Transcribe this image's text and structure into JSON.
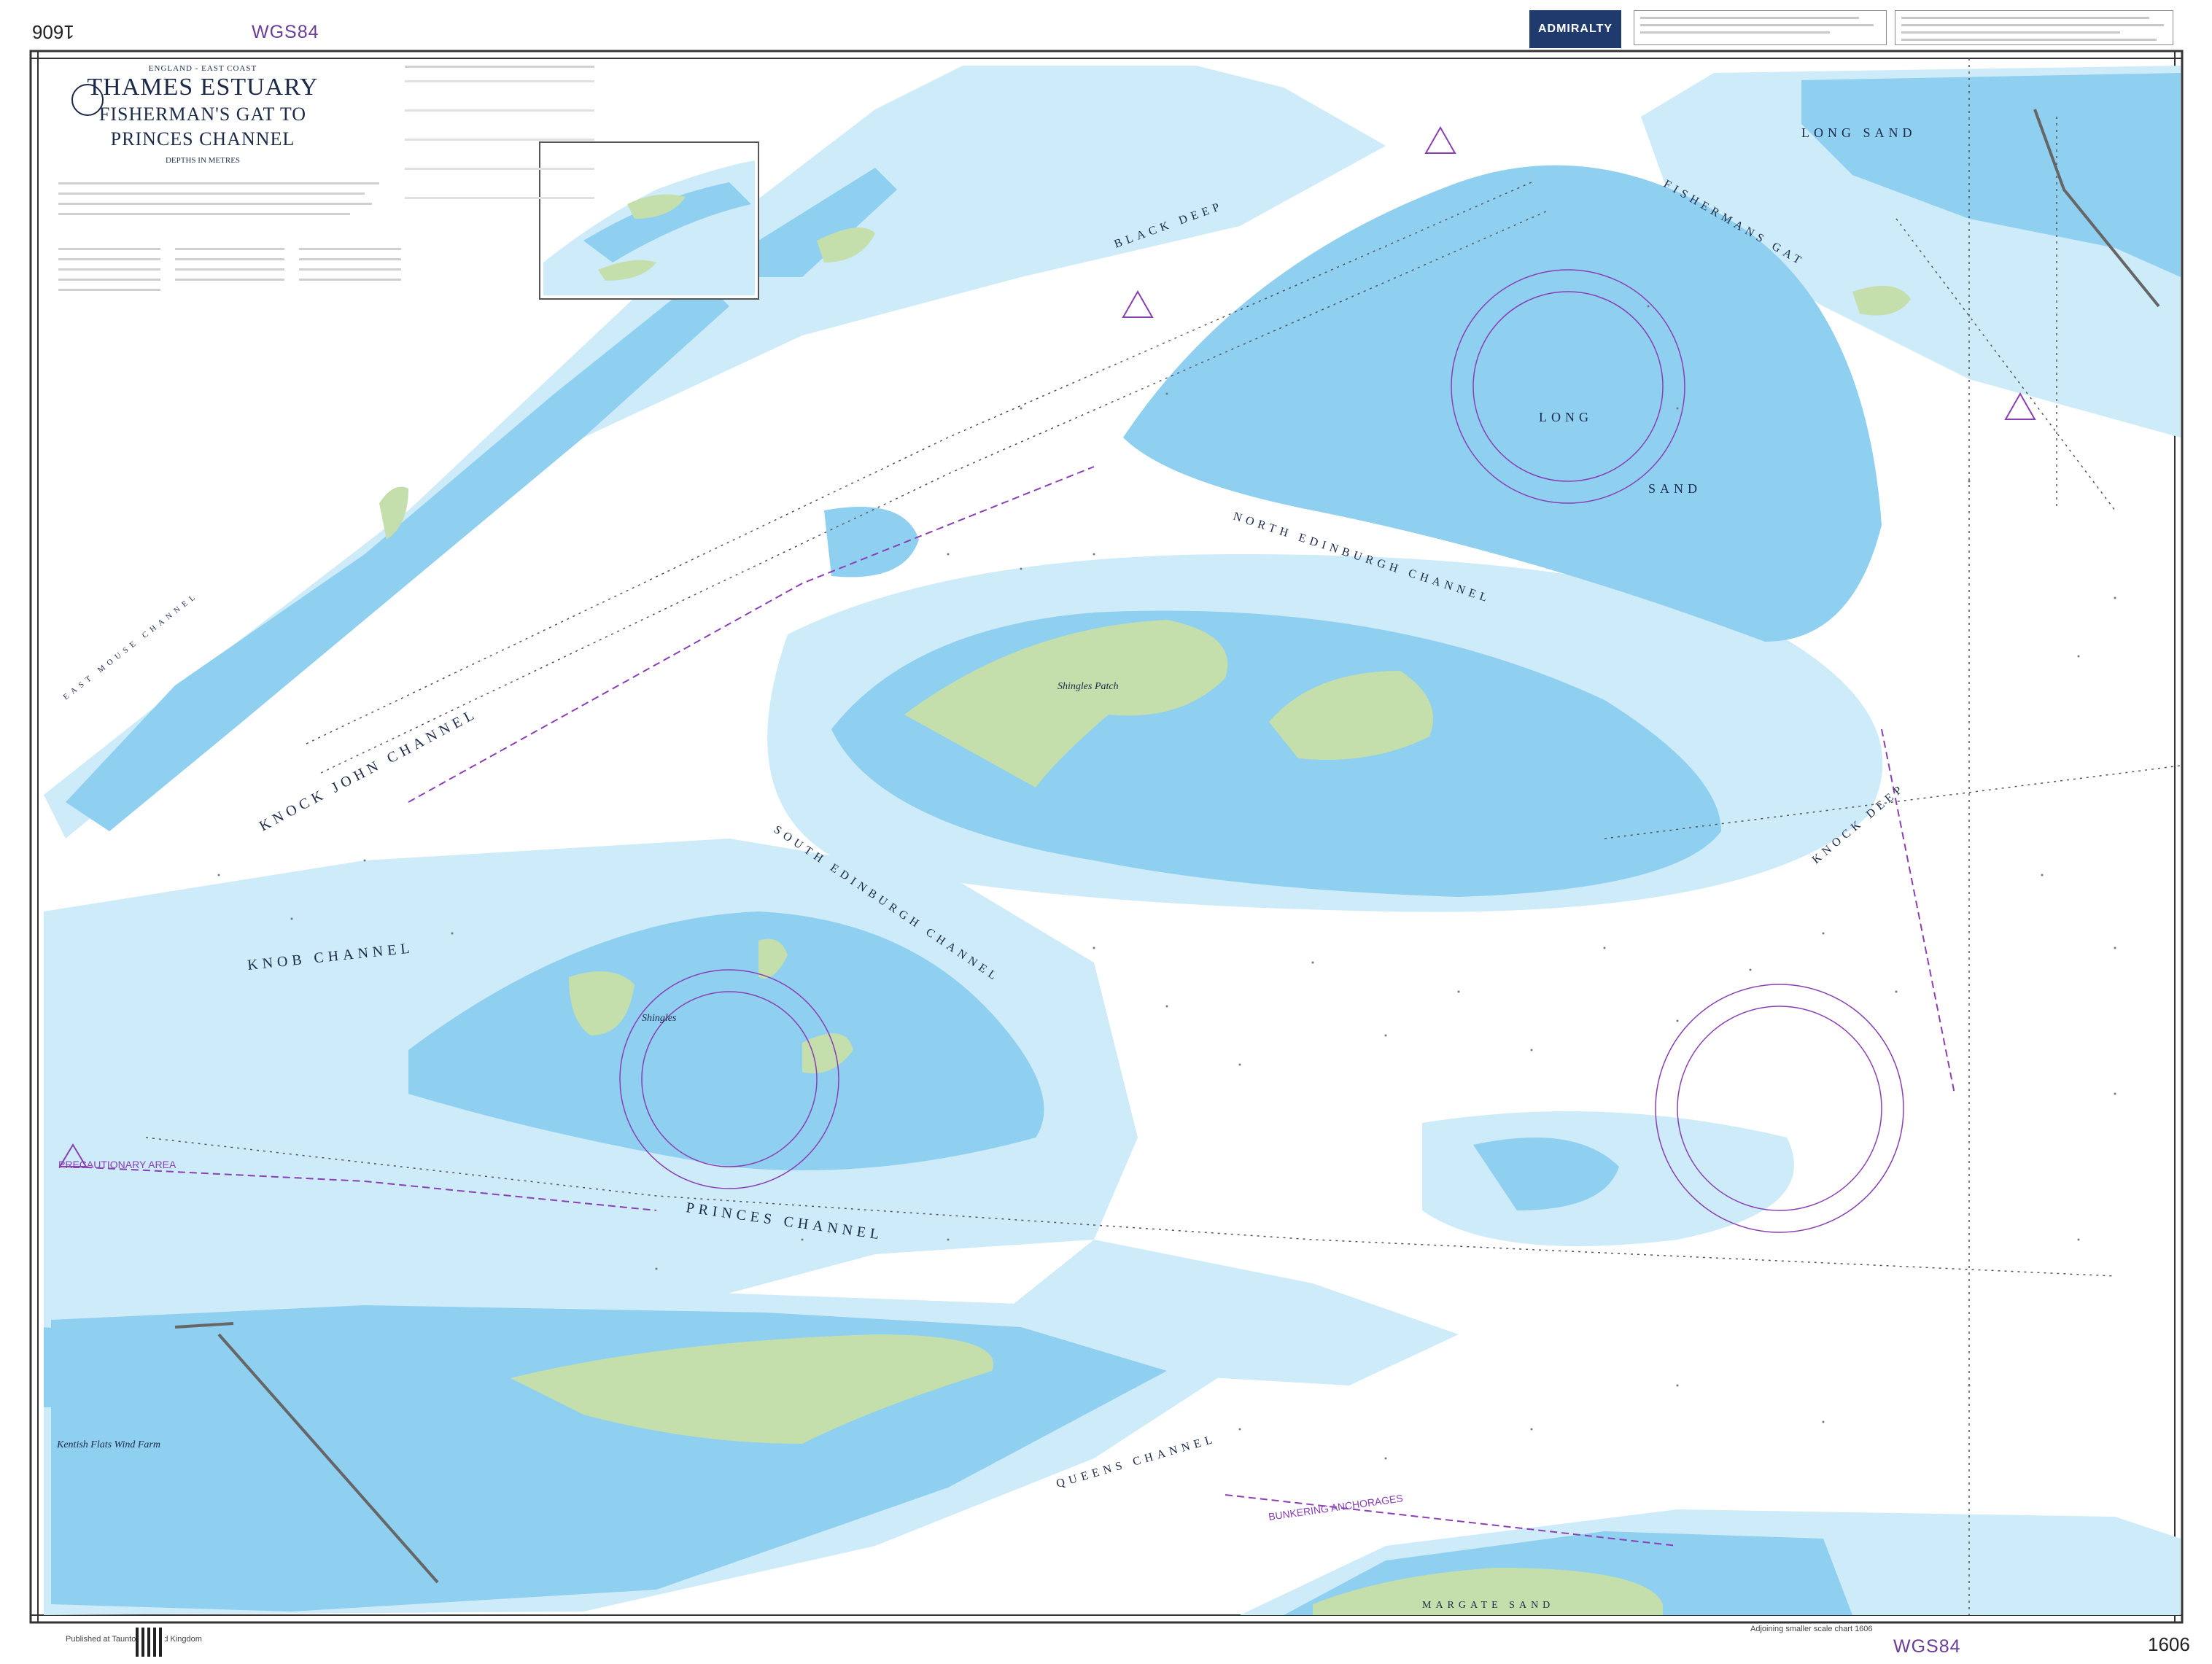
{
  "chart": {
    "number": "1606",
    "number_inverted": "1606",
    "datum_top": "WGS84",
    "datum_bottom": "WGS84",
    "publisher": "ADMIRALTY"
  },
  "title": {
    "region": "ENGLAND - EAST COAST",
    "main": "THAMES ESTUARY",
    "sub1": "FISHERMAN'S GAT TO",
    "sub2": "PRINCES CHANNEL",
    "depths": "DEPTHS IN METRES"
  },
  "places": {
    "long_sand_ne": "LONG SAND",
    "long": "LONG",
    "sand": "SAND",
    "north_edinburgh": "NORTH EDINBURGH CHANNEL",
    "south_edinburgh": "SOUTH EDINBURGH CHANNEL",
    "knock_john": "KNOCK JOHN CHANNEL",
    "knob_channel": "KNOB CHANNEL",
    "princes_channel": "PRINCES CHANNEL",
    "queens_channel": "QUEENS CHANNEL",
    "fishermans_gat": "FISHERMANS GAT",
    "margate_sand": "MARGATE SAND",
    "shingles_patch": "Shingles Patch",
    "shingles": "Shingles",
    "kentish_flats": "Kentish Flats Wind Farm",
    "east_mouse": "EAST MOUSE CHANNEL",
    "knock_deep": "KNOCK DEEP",
    "black_deep": "BLACK DEEP",
    "bunkering": "BUNKERING ANCHORAGES",
    "precautionary": "PRECAUTIONARY AREA"
  },
  "colors": {
    "drying": "#c4dfac",
    "shallow_deep": "#8fcff0",
    "shallow_light": "#cdebf8",
    "deep_water": "#ffffff",
    "magenta": "#8a3fb5",
    "frame": "#333333"
  },
  "footer": {
    "left": "Published at Taunton, United Kingdom",
    "right": "Adjoining smaller scale chart 1606"
  }
}
